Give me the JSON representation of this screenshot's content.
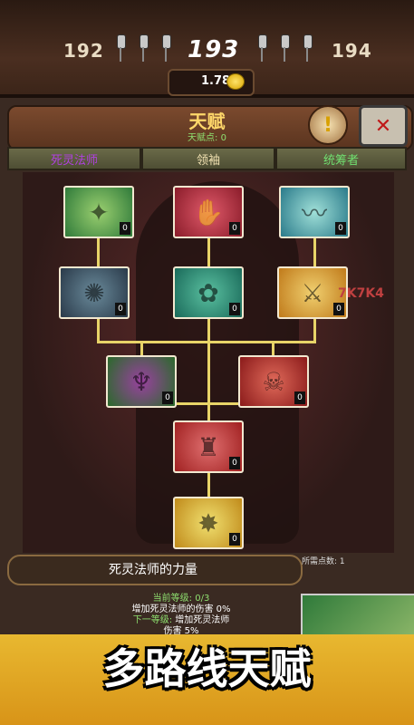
{
  "top_bar": {
    "level_prev": "192",
    "level_current": "193",
    "level_next": "194",
    "currency": "1.78"
  },
  "panel": {
    "title": "天赋",
    "talent_points": "天赋点: 0",
    "help_label": "!",
    "close_label": "✕",
    "tabs": [
      {
        "label": "死灵法师",
        "color": "#b040e0"
      },
      {
        "label": "领袖",
        "color": "#f0e0b0"
      },
      {
        "label": "统筹者",
        "color": "#70e070"
      }
    ]
  },
  "talents": [
    {
      "rank": "0",
      "colors": [
        "#2f7a3a",
        "#9bd070"
      ],
      "glyph": "✦"
    },
    {
      "rank": "0",
      "colors": [
        "#8a1c2a",
        "#e05a6a"
      ],
      "glyph": "✋"
    },
    {
      "rank": "0",
      "colors": [
        "#2a7a8a",
        "#a0e0d8"
      ],
      "glyph": "〰"
    },
    {
      "rank": "0",
      "colors": [
        "#2a3a4a",
        "#6a8a9a"
      ],
      "glyph": "✺"
    },
    {
      "rank": "0",
      "colors": [
        "#1a6a5a",
        "#5ac0a0"
      ],
      "glyph": "✿"
    },
    {
      "rank": "0",
      "colors": [
        "#c07a1a",
        "#f0d070"
      ],
      "glyph": "⚔"
    },
    {
      "rank": "0",
      "colors": [
        "#2a6a2a",
        "#9a40a0"
      ],
      "glyph": "♆"
    },
    {
      "rank": "0",
      "colors": [
        "#8a1a1a",
        "#e06a5a"
      ],
      "glyph": "☠"
    },
    {
      "rank": "0",
      "colors": [
        "#a02020",
        "#e07070"
      ],
      "glyph": "♜"
    },
    {
      "rank": "0",
      "colors": [
        "#c08a1a",
        "#f0e070"
      ],
      "glyph": "✸"
    }
  ],
  "info": {
    "selected_name": "死灵法师的力量",
    "points_needed": "所需点数: 1",
    "current_level": "当前等级: 0/3",
    "current_effect": "增加死灵法师的伤害 0%",
    "next_level_label": "下一等级:",
    "next_effect": "增加死灵法师",
    "next_effect_2": "伤害 5%"
  },
  "banner": {
    "text": "多路线天赋"
  },
  "watermark": "7K7K4"
}
